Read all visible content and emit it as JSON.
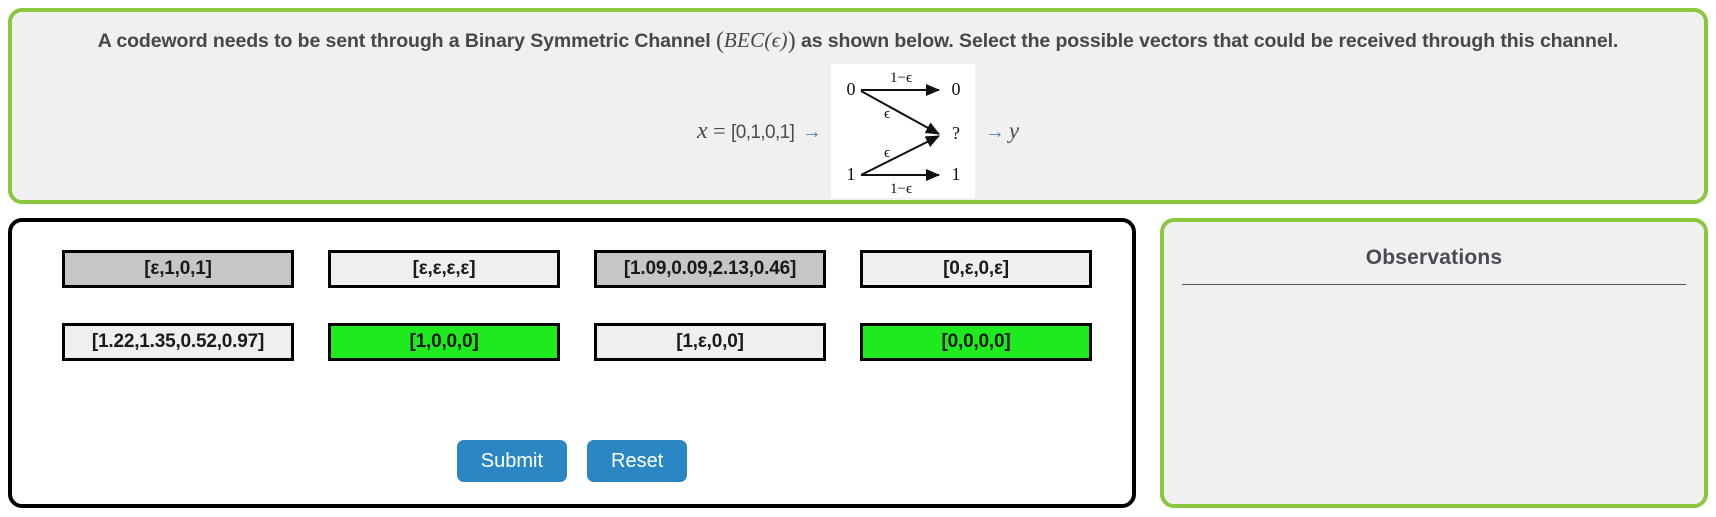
{
  "question": {
    "text_before_math": "A codeword needs to be sent through a Binary Symmetric Channel",
    "math_open_paren": "(",
    "math_label": "BEC",
    "math_inner_open": "(",
    "math_epsilon": "ϵ",
    "math_inner_close": ")",
    "math_close_paren": ")",
    "text_after_math": "as shown below. Select the possible vectors that could be received through this channel."
  },
  "diagram": {
    "input_var": "x",
    "input_equals": "=",
    "input_vector": "[0,1,0,1]",
    "input_arrow": "→",
    "output_arrow": "→",
    "output_var": "y",
    "nodes_in": [
      "0",
      "1"
    ],
    "nodes_out": [
      "0",
      "?",
      "1"
    ],
    "edge_labels": {
      "top": "1−ϵ",
      "upper_erase": "ϵ",
      "lower_erase": "ϵ",
      "bottom": "1−ϵ"
    }
  },
  "options": [
    {
      "label": "[ε,1,0,1]",
      "state": "hover"
    },
    {
      "label": "[ε,ε,ε,ε]",
      "state": "normal"
    },
    {
      "label": "[1.09,0.09,2.13,0.46]",
      "state": "hover"
    },
    {
      "label": "[0,ε,0,ε]",
      "state": "normal"
    },
    {
      "label": "[1.22,1.35,0.52,0.97]",
      "state": "normal"
    },
    {
      "label": "[1,0,0,0]",
      "state": "selected"
    },
    {
      "label": "[1,ε,0,0]",
      "state": "normal"
    },
    {
      "label": "[0,0,0,0]",
      "state": "selected"
    }
  ],
  "actions": {
    "submit_label": "Submit",
    "reset_label": "Reset"
  },
  "observations": {
    "title": "Observations",
    "content": ""
  },
  "colors": {
    "panel_green_border": "#8cc63e",
    "panel_bg": "#f0f0f0",
    "answer_border": "#000000",
    "selected_green": "#1eeb1e",
    "hover_gray": "#c6c6c6",
    "option_bg": "#efefef",
    "action_blue": "#2b87c3"
  }
}
